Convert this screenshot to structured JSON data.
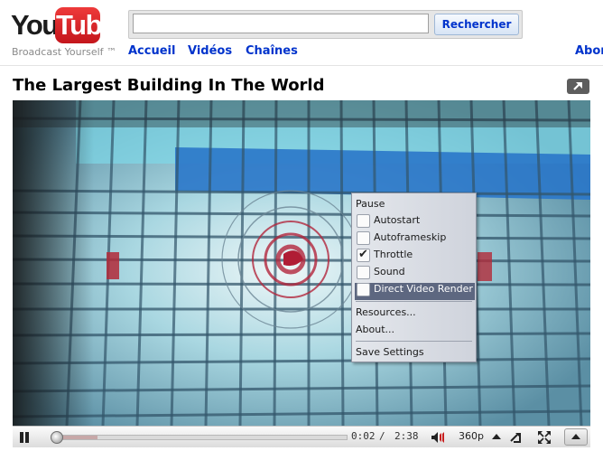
{
  "header": {
    "logo_you": "You",
    "logo_tube": "Tube",
    "tagline": "Broadcast Yourself ™",
    "search_value": "",
    "search_button": "Rechercher",
    "nav": [
      "Accueil",
      "Vidéos",
      "Chaînes",
      "Abor"
    ]
  },
  "video": {
    "title": "The Largest Building In The World"
  },
  "context_menu": {
    "pause": "Pause",
    "options": [
      {
        "label": "Autostart",
        "checked": false
      },
      {
        "label": "Autoframeskip",
        "checked": false
      },
      {
        "label": "Throttle",
        "checked": true
      },
      {
        "label": "Sound",
        "checked": false
      },
      {
        "label": "Direct Video Render",
        "checked": false
      }
    ],
    "highlighted": "Direct Video Render",
    "resources": "Resources...",
    "about": "About...",
    "save_settings": "Save Settings"
  },
  "player": {
    "current_time": "0:02",
    "separator": "/",
    "duration": "2:38",
    "quality": "360p",
    "played_fraction": 0.013,
    "loaded_fraction": 0.15
  }
}
